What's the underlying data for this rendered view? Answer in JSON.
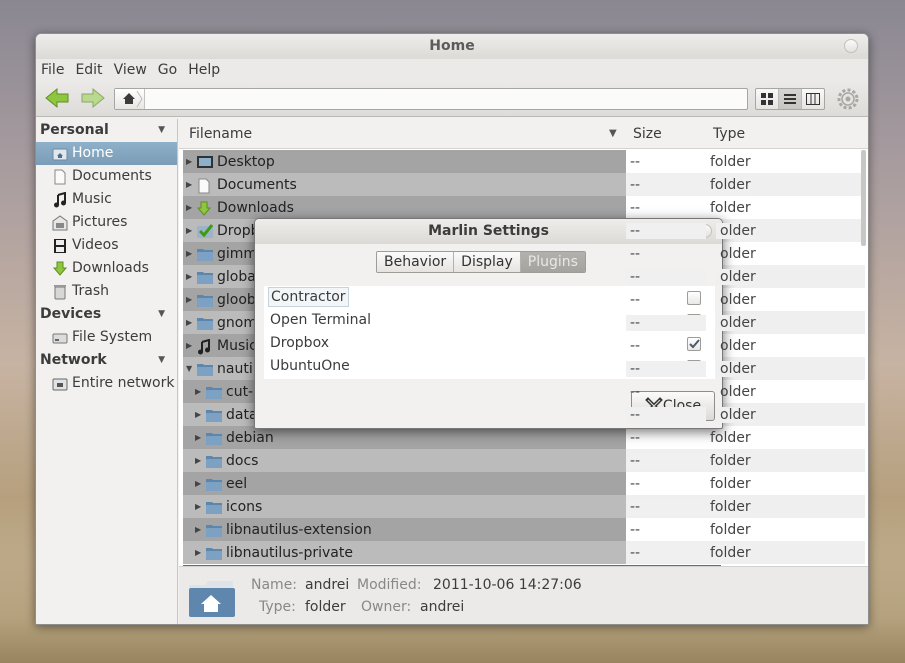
{
  "window": {
    "title": "Home"
  },
  "menu": [
    "File",
    "Edit",
    "View",
    "Go",
    "Help"
  ],
  "sidebar": {
    "sections": [
      {
        "title": "Personal",
        "items": [
          {
            "label": "Home",
            "icon": "home-folder-icon",
            "selected": true
          },
          {
            "label": "Documents",
            "icon": "document-icon"
          },
          {
            "label": "Music",
            "icon": "music-icon"
          },
          {
            "label": "Pictures",
            "icon": "pictures-icon"
          },
          {
            "label": "Videos",
            "icon": "videos-icon"
          },
          {
            "label": "Downloads",
            "icon": "downloads-icon"
          },
          {
            "label": "Trash",
            "icon": "trash-icon"
          }
        ]
      },
      {
        "title": "Devices",
        "items": [
          {
            "label": "File System",
            "icon": "drive-icon"
          }
        ]
      },
      {
        "title": "Network",
        "items": [
          {
            "label": "Entire network",
            "icon": "network-icon"
          }
        ]
      }
    ]
  },
  "columns": {
    "filename": "Filename",
    "size": "Size",
    "type": "Type"
  },
  "rows": [
    {
      "name": "Desktop",
      "size": "--",
      "type": "folder",
      "indent": 0,
      "icon": "desktop-icon"
    },
    {
      "name": "Documents",
      "size": "--",
      "type": "folder",
      "indent": 0,
      "icon": "document-icon"
    },
    {
      "name": "Downloads",
      "size": "--",
      "type": "folder",
      "indent": 0,
      "icon": "downloads-icon"
    },
    {
      "name": "Dropb",
      "size": "--",
      "type": "older",
      "indent": 0,
      "icon": "dropbox-icon"
    },
    {
      "name": "gimm",
      "size": "--",
      "type": "older",
      "indent": 0,
      "icon": "folder-icon"
    },
    {
      "name": "globa",
      "size": "--",
      "type": "older",
      "indent": 0,
      "icon": "folder-icon"
    },
    {
      "name": "gloob",
      "size": "--",
      "type": "older",
      "indent": 0,
      "icon": "folder-icon"
    },
    {
      "name": "gnom",
      "size": "--",
      "type": "older",
      "indent": 0,
      "icon": "folder-icon"
    },
    {
      "name": "Music",
      "size": "--",
      "type": "older",
      "indent": 0,
      "icon": "music-icon"
    },
    {
      "name": "nautil",
      "size": "--",
      "type": "older",
      "indent": 0,
      "icon": "folder-icon",
      "expanded": true
    },
    {
      "name": "cut-n",
      "size": "--",
      "type": "older",
      "indent": 1,
      "icon": "folder-icon"
    },
    {
      "name": "data",
      "size": "--",
      "type": "older",
      "indent": 1,
      "icon": "folder-icon"
    },
    {
      "name": "debian",
      "size": "--",
      "type": "folder",
      "indent": 1,
      "icon": "folder-icon"
    },
    {
      "name": "docs",
      "size": "--",
      "type": "folder",
      "indent": 1,
      "icon": "folder-icon"
    },
    {
      "name": "eel",
      "size": "--",
      "type": "folder",
      "indent": 1,
      "icon": "folder-icon"
    },
    {
      "name": "icons",
      "size": "--",
      "type": "folder",
      "indent": 1,
      "icon": "folder-icon"
    },
    {
      "name": "libnautilus-extension",
      "size": "--",
      "type": "folder",
      "indent": 1,
      "icon": "folder-icon"
    },
    {
      "name": "libnautilus-private",
      "size": "--",
      "type": "folder",
      "indent": 1,
      "icon": "folder-icon"
    }
  ],
  "status": {
    "name_label": "Name:",
    "name": "andrei",
    "modified_label": "Modified:",
    "modified": "2011-10-06 14:27:06",
    "type_label": "Type:",
    "type": "folder",
    "owner_label": "Owner:",
    "owner": "andrei"
  },
  "dialog": {
    "title": "Marlin Settings",
    "tabs": [
      {
        "label": "Behavior",
        "active": false
      },
      {
        "label": "Display",
        "active": false
      },
      {
        "label": "Plugins",
        "active": true
      }
    ],
    "plugins": [
      {
        "name": "Contractor",
        "enabled": false,
        "focused": true
      },
      {
        "name": "Open Terminal",
        "enabled": false
      },
      {
        "name": "Dropbox",
        "enabled": true
      },
      {
        "name": "UbuntuOne",
        "enabled": true
      }
    ],
    "close_label": "Close"
  }
}
